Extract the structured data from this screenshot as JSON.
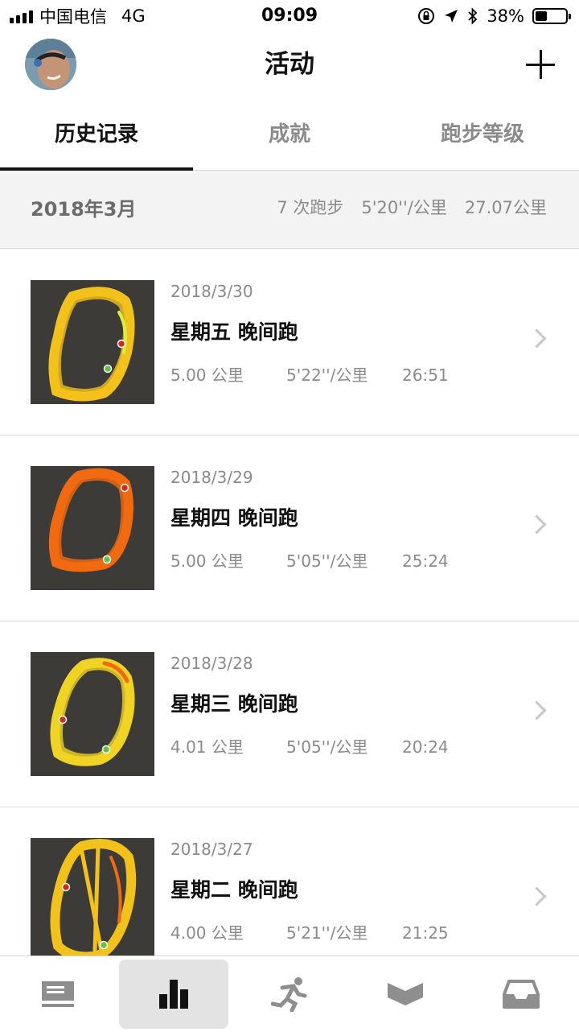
{
  "status_bar": {
    "carrier": "中国电信",
    "network": "4G",
    "time": "09:09",
    "battery": "38%",
    "battery_level": 0.38
  },
  "nav": {
    "title": "活动",
    "avatar_icon": "user-avatar",
    "add_icon": "plus-icon"
  },
  "tabs": [
    {
      "label": "历史记录",
      "active": true
    },
    {
      "label": "成就",
      "active": false
    },
    {
      "label": "跑步等级",
      "active": false
    }
  ],
  "month_summary": {
    "month": "2018年3月",
    "runs": "7 次跑步",
    "pace": "5'20''/公里",
    "distance": "27.07公里"
  },
  "activities": [
    {
      "date": "2018/3/30",
      "title": "星期五 晚间跑",
      "distance": "5.00 公里",
      "pace": "5'22''/公里",
      "duration": "26:51",
      "route_color": "#f2c21b"
    },
    {
      "date": "2018/3/29",
      "title": "星期四 晚间跑",
      "distance": "5.00 公里",
      "pace": "5'05''/公里",
      "duration": "25:24",
      "route_color": "#f26a0f"
    },
    {
      "date": "2018/3/28",
      "title": "星期三 晚间跑",
      "distance": "4.01 公里",
      "pace": "5'05''/公里",
      "duration": "20:24",
      "route_color": "#f0d424"
    },
    {
      "date": "2018/3/27",
      "title": "星期二 晚间跑",
      "distance": "4.00 公里",
      "pace": "5'21''/公里",
      "duration": "21:25",
      "route_color": "#f2c21b"
    }
  ],
  "tabbar": [
    {
      "icon": "feed-icon",
      "active": false
    },
    {
      "icon": "activity-chart-icon",
      "active": true
    },
    {
      "icon": "runner-icon",
      "active": false
    },
    {
      "icon": "coach-icon",
      "active": false
    },
    {
      "icon": "inbox-icon",
      "active": false
    }
  ],
  "colors": {
    "accent": "#111111",
    "secondary_text": "#8a8a8a",
    "summary_bg": "#f3f3f3",
    "thumb_bg": "#3d3b38",
    "start_dot": "#5ec24a",
    "end_dot": "#d42a1c"
  }
}
